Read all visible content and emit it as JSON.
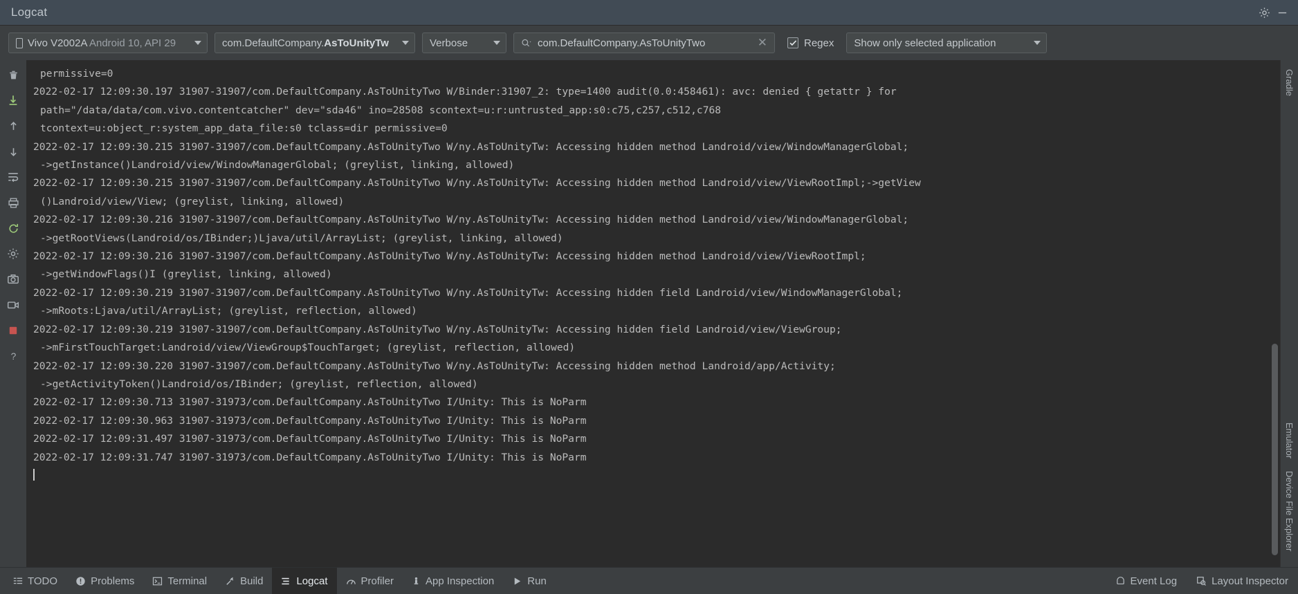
{
  "window": {
    "title": "Logcat",
    "settings_icon": "gear-icon",
    "minimize_icon": "minimize-icon"
  },
  "toolbar": {
    "device": {
      "icon": "phone-icon",
      "name": "Vivo V2002A",
      "details": "Android 10, API 29"
    },
    "process": {
      "prefix": "com.DefaultCompany.",
      "bold": "AsToUnityTw"
    },
    "log_level": "Verbose",
    "search": {
      "icon": "search-icon",
      "value": "com.DefaultCompany.AsToUnityTwo",
      "placeholder": "",
      "clear_icon": "close-icon"
    },
    "regex": {
      "label": "Regex",
      "checked": true
    },
    "filter": "Show only selected application"
  },
  "left_rail": [
    {
      "name": "clear-logcat-button",
      "icon": "trash-icon"
    },
    {
      "name": "scroll-to-end-button",
      "icon": "scroll-end-icon"
    },
    {
      "name": "up-the-stack-trace-button",
      "icon": "arrow-up-icon"
    },
    {
      "name": "down-the-stack-trace-button",
      "icon": "arrow-down-icon"
    },
    {
      "name": "soft-wraps-button",
      "icon": "soft-wrap-icon"
    },
    {
      "name": "print-button",
      "icon": "print-icon"
    },
    {
      "name": "restart-button",
      "icon": "restart-icon"
    },
    {
      "name": "settings-button",
      "icon": "gear-icon"
    },
    {
      "name": "screenshot-button",
      "icon": "camera-icon"
    },
    {
      "name": "screen-record-button",
      "icon": "video-icon"
    },
    {
      "name": "stop-button",
      "icon": "stop-square-icon"
    },
    {
      "name": "help-button",
      "icon": "question-icon"
    }
  ],
  "log": {
    "lines": [
      {
        "indent": true,
        "text": "permissive=0"
      },
      {
        "indent": false,
        "text": "2022-02-17 12:09:30.197 31907-31907/com.DefaultCompany.AsToUnityTwo W/Binder:31907_2: type=1400 audit(0.0:458461): avc: denied { getattr } for"
      },
      {
        "indent": true,
        "text": "path=\"/data/data/com.vivo.contentcatcher\" dev=\"sda46\" ino=28508 scontext=u:r:untrusted_app:s0:c75,c257,c512,c768"
      },
      {
        "indent": true,
        "text": "tcontext=u:object_r:system_app_data_file:s0 tclass=dir permissive=0"
      },
      {
        "indent": false,
        "text": "2022-02-17 12:09:30.215 31907-31907/com.DefaultCompany.AsToUnityTwo W/ny.AsToUnityTw: Accessing hidden method Landroid/view/WindowManagerGlobal;"
      },
      {
        "indent": true,
        "text": "->getInstance()Landroid/view/WindowManagerGlobal; (greylist, linking, allowed)"
      },
      {
        "indent": false,
        "text": "2022-02-17 12:09:30.215 31907-31907/com.DefaultCompany.AsToUnityTwo W/ny.AsToUnityTw: Accessing hidden method Landroid/view/ViewRootImpl;->getView"
      },
      {
        "indent": true,
        "text": "()Landroid/view/View; (greylist, linking, allowed)"
      },
      {
        "indent": false,
        "text": "2022-02-17 12:09:30.216 31907-31907/com.DefaultCompany.AsToUnityTwo W/ny.AsToUnityTw: Accessing hidden method Landroid/view/WindowManagerGlobal;"
      },
      {
        "indent": true,
        "text": "->getRootViews(Landroid/os/IBinder;)Ljava/util/ArrayList; (greylist, linking, allowed)"
      },
      {
        "indent": false,
        "text": "2022-02-17 12:09:30.216 31907-31907/com.DefaultCompany.AsToUnityTwo W/ny.AsToUnityTw: Accessing hidden method Landroid/view/ViewRootImpl;"
      },
      {
        "indent": true,
        "text": "->getWindowFlags()I (greylist, linking, allowed)"
      },
      {
        "indent": false,
        "text": "2022-02-17 12:09:30.219 31907-31907/com.DefaultCompany.AsToUnityTwo W/ny.AsToUnityTw: Accessing hidden field Landroid/view/WindowManagerGlobal;"
      },
      {
        "indent": true,
        "text": "->mRoots:Ljava/util/ArrayList; (greylist, reflection, allowed)"
      },
      {
        "indent": false,
        "text": "2022-02-17 12:09:30.219 31907-31907/com.DefaultCompany.AsToUnityTwo W/ny.AsToUnityTw: Accessing hidden field Landroid/view/ViewGroup;"
      },
      {
        "indent": true,
        "text": "->mFirstTouchTarget:Landroid/view/ViewGroup$TouchTarget; (greylist, reflection, allowed)"
      },
      {
        "indent": false,
        "text": "2022-02-17 12:09:30.220 31907-31907/com.DefaultCompany.AsToUnityTwo W/ny.AsToUnityTw: Accessing hidden method Landroid/app/Activity;"
      },
      {
        "indent": true,
        "text": "->getActivityToken()Landroid/os/IBinder; (greylist, reflection, allowed)"
      },
      {
        "indent": false,
        "text": "2022-02-17 12:09:30.713 31907-31973/com.DefaultCompany.AsToUnityTwo I/Unity: This is NoParm"
      },
      {
        "indent": false,
        "text": "2022-02-17 12:09:30.963 31907-31973/com.DefaultCompany.AsToUnityTwo I/Unity: This is NoParm"
      },
      {
        "indent": false,
        "text": "2022-02-17 12:09:31.497 31907-31973/com.DefaultCompany.AsToUnityTwo I/Unity: This is NoParm"
      },
      {
        "indent": false,
        "text": "2022-02-17 12:09:31.747 31907-31973/com.DefaultCompany.AsToUnityTwo I/Unity: This is NoParm"
      }
    ]
  },
  "right_rail": [
    {
      "label": "Gradle",
      "icon": "gradle-icon"
    },
    {
      "label": "Emulator",
      "icon": "emulator-icon"
    },
    {
      "label": "Device File Explorer",
      "icon": "device-file-icon"
    }
  ],
  "bottom_tabs": [
    {
      "label": "TODO",
      "icon": "list-icon",
      "active": false
    },
    {
      "label": "Problems",
      "icon": "warning-icon",
      "active": false
    },
    {
      "label": "Terminal",
      "icon": "terminal-icon",
      "active": false
    },
    {
      "label": "Build",
      "icon": "hammer-icon",
      "active": false
    },
    {
      "label": "Logcat",
      "icon": "logcat-icon",
      "active": true
    },
    {
      "label": "Profiler",
      "icon": "profiler-icon",
      "active": false
    },
    {
      "label": "App Inspection",
      "icon": "inspection-icon",
      "active": false
    },
    {
      "label": "Run",
      "icon": "play-icon",
      "active": false
    }
  ],
  "bottom_right_tabs": [
    {
      "label": "Event Log",
      "icon": "event-log-icon"
    },
    {
      "label": "Layout Inspector",
      "icon": "layout-inspector-icon"
    }
  ],
  "colors": {
    "panel": "#3c3f41",
    "titlebar": "#414b55",
    "console_bg": "#2b2b2b",
    "text": "#bbbbbb"
  }
}
